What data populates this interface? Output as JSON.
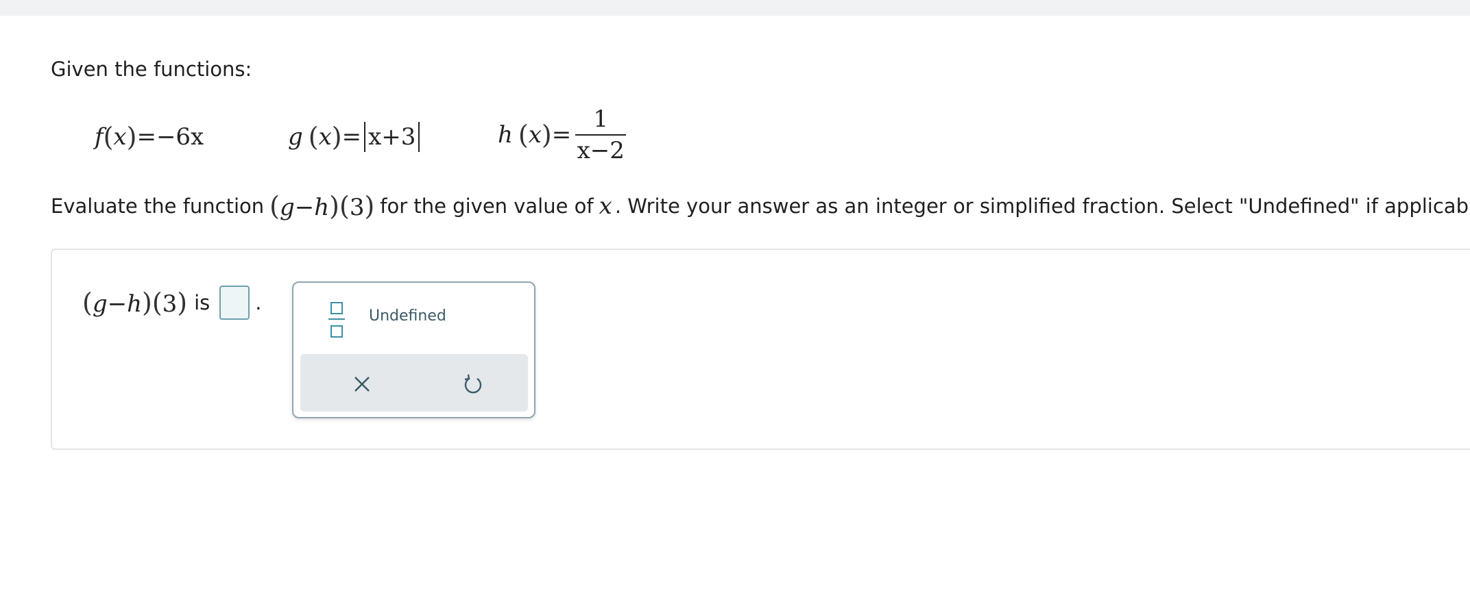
{
  "prompt": {
    "intro": "Given the functions:",
    "f": {
      "name": "f",
      "var": "x",
      "eq": "=",
      "rhs": "−6x"
    },
    "g": {
      "name": "g",
      "var": "x",
      "eq": "=",
      "inner": "x+3"
    },
    "h": {
      "name": "h",
      "var": "x",
      "eq": "=",
      "numerator": "1",
      "denominator": "x−2"
    },
    "evaluate_before": "Evaluate the function",
    "expr_left": "g−h",
    "expr_arg": "3",
    "evaluate_mid": "for the given value of",
    "evaluate_var": "x",
    "evaluate_after": ". Write your answer as an integer or simplified fraction. Select \"Undefined\" if applicable."
  },
  "answer": {
    "expr_left": "g−h",
    "expr_arg": "3",
    "is_label": "is",
    "value": "",
    "period": "."
  },
  "keypad": {
    "fraction_key": "fraction-icon",
    "undefined_label": "Undefined",
    "clear_icon": "close-icon",
    "undo_icon": "undo-icon"
  },
  "colors": {
    "accent": "#3e8ea8",
    "keypad_border": "#8ea6b0",
    "answer_blank_bg": "#eef5f7"
  }
}
